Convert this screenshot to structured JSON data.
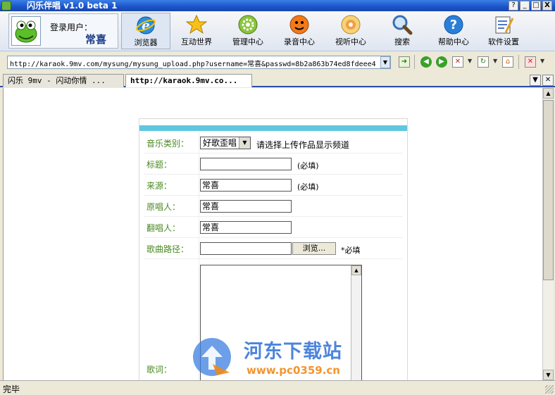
{
  "window": {
    "title": "闪乐伴唱 v1.0 beta 1",
    "controls": [
      "?",
      "_",
      "□",
      "X"
    ]
  },
  "toolbar": {
    "login_label": "登录用户：",
    "username": "常喜",
    "buttons": [
      {
        "label": "浏览器",
        "icon": "ie-browser-icon"
      },
      {
        "label": "互动世界",
        "icon": "star-icon"
      },
      {
        "label": "管理中心",
        "icon": "gear-icon"
      },
      {
        "label": "录音中心",
        "icon": "microphone-face-icon"
      },
      {
        "label": "视听中心",
        "icon": "cd-disc-icon"
      },
      {
        "label": "搜索",
        "icon": "magnifier-icon"
      },
      {
        "label": "帮助中心",
        "icon": "help-icon"
      },
      {
        "label": "软件设置",
        "icon": "settings-notepad-icon"
      }
    ],
    "accent": "#1a3c88"
  },
  "address": {
    "url": "http://karaok.9mv.com/mysung/mysung_upload.php?username=常喜&passwd=8b2a863b74ed8fdeee4"
  },
  "tabs": [
    {
      "label": "闪乐 9mv - 闪动你情 ..."
    },
    {
      "label": "http://karaok.9mv.co..."
    }
  ],
  "form": {
    "accent": "#5fc7e0",
    "label_color": "#4a8a22",
    "category_label": "音乐类别：",
    "category_value": "好歌歪唱",
    "category_hint": "请选择上传作品显示频道",
    "title_label": "标题：",
    "title_value": "",
    "title_hint": "(必填)",
    "source_label": "来源：",
    "source_value": "常喜",
    "source_hint": "(必填)",
    "original_singer_label": "原唱人：",
    "original_singer_value": "常喜",
    "cover_singer_label": "翻唱人：",
    "cover_singer_value": "常喜",
    "song_path_label": "歌曲路径：",
    "song_path_value": "",
    "browse_label": "浏览...",
    "song_path_hint": "*必填",
    "lyrics_label": "歌词："
  },
  "watermark": {
    "name": "河东下载站",
    "url": "www.pc0359.cn"
  },
  "status": {
    "text": "完毕"
  }
}
